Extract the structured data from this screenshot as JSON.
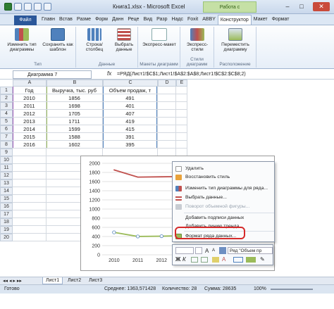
{
  "window": {
    "title": "Книга1.xlsx - Microsoft Excel",
    "context_tab_title": "Работа с диаграммами",
    "minimize": "–",
    "maximize": "□",
    "close": "✕"
  },
  "ribbon_tabs": [
    "Файл",
    "Главн",
    "Встав",
    "Разме",
    "Форм",
    "Данн",
    "Реце",
    "Вид",
    "Разр",
    "Надс",
    "Foxit",
    "ABBY",
    "Конструктор",
    "Макет",
    "Формат"
  ],
  "ribbon": {
    "groups": [
      {
        "label": "Тип",
        "buttons": [
          "Изменить тип диаграммы",
          "Сохранить как шаблон"
        ]
      },
      {
        "label": "Данные",
        "buttons": [
          "Строка/столбец",
          "Выбрать данные"
        ]
      },
      {
        "label": "Макеты диаграмм",
        "buttons": [
          "Экспресс-макет"
        ]
      },
      {
        "label": "Стили диаграмм",
        "buttons": [
          "Экспресс-стили"
        ]
      },
      {
        "label": "Расположение",
        "buttons": [
          "Переместить диаграмму"
        ]
      }
    ]
  },
  "formula_bar": {
    "name_box": "Диаграмма 7",
    "fx": "fx",
    "formula": "=РЯД(Лист1!$C$1;Лист1!$A$2:$A$8;Лист1!$C$2:$C$8;2)"
  },
  "sheet": {
    "columns": [
      "A",
      "B",
      "C",
      "D",
      "E"
    ],
    "rows": [
      "1",
      "2",
      "3",
      "4",
      "5",
      "6",
      "7",
      "8",
      "9",
      "10",
      "11",
      "12",
      "13",
      "14",
      "15",
      "16",
      "17",
      "18",
      "19",
      "20"
    ],
    "header": [
      "Год",
      "Выручка, тыс. руб",
      "Объем продаж, т"
    ],
    "data": [
      [
        "2010",
        "1856",
        "491"
      ],
      [
        "2011",
        "1698",
        "401"
      ],
      [
        "2012",
        "1705",
        "407"
      ],
      [
        "2013",
        "1711",
        "419"
      ],
      [
        "2014",
        "1599",
        "415"
      ],
      [
        "2015",
        "1588",
        "391"
      ],
      [
        "2016",
        "1602",
        "395"
      ]
    ]
  },
  "chart_data": {
    "type": "line",
    "categories": [
      "2010",
      "2011",
      "2012",
      "2013",
      "2014",
      "2015",
      "2016"
    ],
    "series": [
      {
        "values": [
          1856,
          1698,
          1705,
          1711,
          1599,
          1588,
          1602
        ],
        "color": "#c0504d"
      },
      {
        "values": [
          491,
          401,
          407,
          419,
          415,
          391,
          395
        ],
        "color": "#9bbb59"
      }
    ],
    "yticks": [
      "2000",
      "1800",
      "1600",
      "1400",
      "1200",
      "1000",
      "800",
      "600",
      "400",
      "200",
      "0"
    ],
    "ylim": [
      0,
      2000
    ],
    "grid": true
  },
  "context_menu": {
    "items": [
      {
        "label": "Удалить",
        "enabled": true
      },
      {
        "label": "Восстановить стиль",
        "enabled": true
      },
      {
        "label": "Изменить тип диаграммы для ряда...",
        "enabled": true
      },
      {
        "label": "Выбрать данные...",
        "enabled": true
      },
      {
        "label": "Поворот объемной фигуры...",
        "enabled": false
      },
      {
        "label": "Добавить подписи данных",
        "enabled": true
      },
      {
        "label": "Добавить линию тренда...",
        "enabled": true
      },
      {
        "label": "Формат ряда данных...",
        "enabled": true
      }
    ]
  },
  "mini_toolbar": {
    "series_select": "Ряд \"Объем пр"
  },
  "sheet_tabs": [
    "Лист1",
    "Лист2",
    "Лист3"
  ],
  "status_bar": {
    "ready": "Готово",
    "average": "Среднее: 1363,571428",
    "count": "Количество: 28",
    "sum": "Сумма: 28635",
    "zoom": "100%"
  },
  "colors": {
    "accent": "#2b579a",
    "context_tab": "#c5e0a5",
    "highlight": "#d62a2a",
    "series1": "#c0504d",
    "series2": "#9bbb59"
  }
}
